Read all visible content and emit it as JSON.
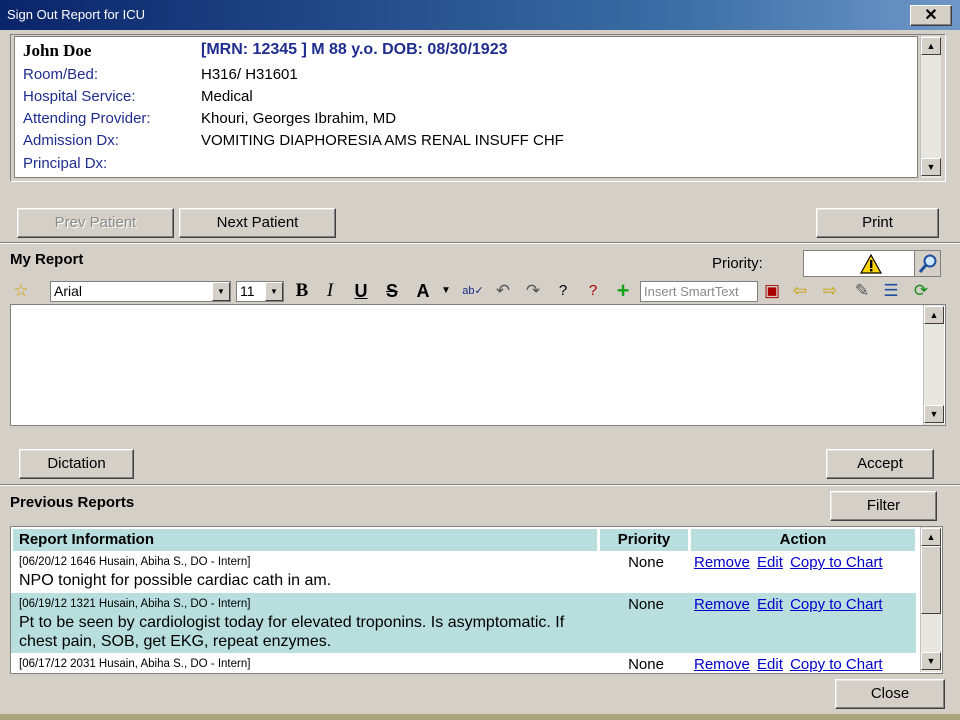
{
  "window": {
    "title": "Sign Out Report for ICU",
    "close_glyph": "✕"
  },
  "patient": {
    "name": "John Doe",
    "mrn_line": "[MRN: 12345 ] M 88 y.o. DOB: 08/30/1923",
    "fields": [
      {
        "label": "Room/Bed:",
        "value": "H316/ H31601"
      },
      {
        "label": "Hospital Service:",
        "value": "Medical"
      },
      {
        "label": "Attending Provider:",
        "value": "Khouri, Georges Ibrahim, MD"
      },
      {
        "label": "Admission Dx:",
        "value": "VOMITING DIAPHORESIA AMS RENAL INSUFF CHF"
      },
      {
        "label": "Principal Dx:",
        "value": ""
      }
    ]
  },
  "nav": {
    "prev": "Prev Patient",
    "next": "Next Patient",
    "print": "Print"
  },
  "my_report": {
    "title": "My Report",
    "priority_label": "Priority:",
    "font": "Arial",
    "size": "11",
    "smarttext_placeholder": "Insert SmartText",
    "dictation": "Dictation",
    "accept": "Accept"
  },
  "previous": {
    "title": "Previous Reports",
    "filter": "Filter",
    "columns": {
      "info": "Report Information",
      "priority": "Priority",
      "action": "Action"
    },
    "actions": {
      "remove": "Remove",
      "edit": "Edit",
      "copy": "Copy to Chart"
    },
    "rows": [
      {
        "meta": "[06/20/12 1646 Husain, Abiha S., DO - Intern]",
        "text": "NPO tonight for possible cardiac cath in am.",
        "priority": "None"
      },
      {
        "meta": "[06/19/12 1321 Husain, Abiha S., DO - Intern]",
        "text": "Pt to be seen by cardiologist today for elevated troponins. Is asymptomatic. If chest pain, SOB, get EKG, repeat enzymes.",
        "priority": "None"
      },
      {
        "meta": "[06/17/12 2031 Husain, Abiha S., DO - Intern]",
        "text": "",
        "priority": "None"
      }
    ]
  },
  "footer": {
    "close": "Close"
  },
  "toolbar_icons": [
    "star-icon",
    "bold-icon",
    "italic-icon",
    "underline-icon",
    "strikethrough-icon",
    "font-color-icon",
    "spellcheck-icon",
    "undo-icon",
    "redo-icon",
    "help-icon",
    "template-help-icon",
    "add-icon",
    "window-icon",
    "arrow-left-icon",
    "arrow-right-icon",
    "brush-icon",
    "list-icon",
    "refresh-icon"
  ],
  "colors": {
    "title_bar": "#0a246a",
    "label_blue": "#1f2d8f",
    "table_header": "#b8dede",
    "link": "#0000cc"
  }
}
